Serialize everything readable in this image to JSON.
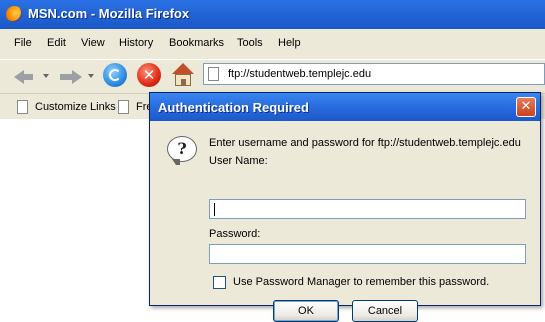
{
  "window": {
    "title": "MSN.com - Mozilla Firefox"
  },
  "menu": {
    "items": [
      "File",
      "Edit",
      "View",
      "History",
      "Bookmarks",
      "Tools",
      "Help"
    ]
  },
  "navigation": {
    "url": "ftp://studentweb.templejc.edu"
  },
  "bookmarks_toolbar": {
    "items": [
      "Customize Links",
      "Fre"
    ]
  },
  "dialog": {
    "title": "Authentication Required",
    "close_glyph": "✕",
    "message": "Enter username and password for ftp://studentweb.templejc.edu",
    "username_label": "User Name:",
    "username_value": "",
    "password_label": "Password:",
    "password_value": "",
    "remember_label": "Use Password Manager to remember this password.",
    "remember_checked": false,
    "ok_label": "OK",
    "cancel_label": "Cancel"
  }
}
